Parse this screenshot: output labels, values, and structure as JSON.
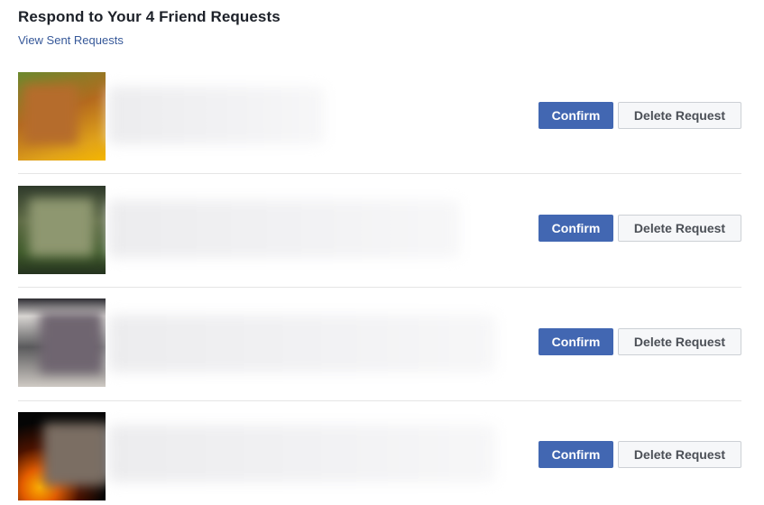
{
  "header": {
    "title": "Respond to Your 4 Friend Requests",
    "sent_link": "View Sent Requests"
  },
  "requests": [
    {
      "confirm_label": "Confirm",
      "delete_label": "Delete Request"
    },
    {
      "confirm_label": "Confirm",
      "delete_label": "Delete Request"
    },
    {
      "confirm_label": "Confirm",
      "delete_label": "Delete Request"
    },
    {
      "confirm_label": "Confirm",
      "delete_label": "Delete Request"
    }
  ],
  "colors": {
    "confirm_button": "#4267b2",
    "link": "#365899",
    "title_text": "#1d2129"
  }
}
